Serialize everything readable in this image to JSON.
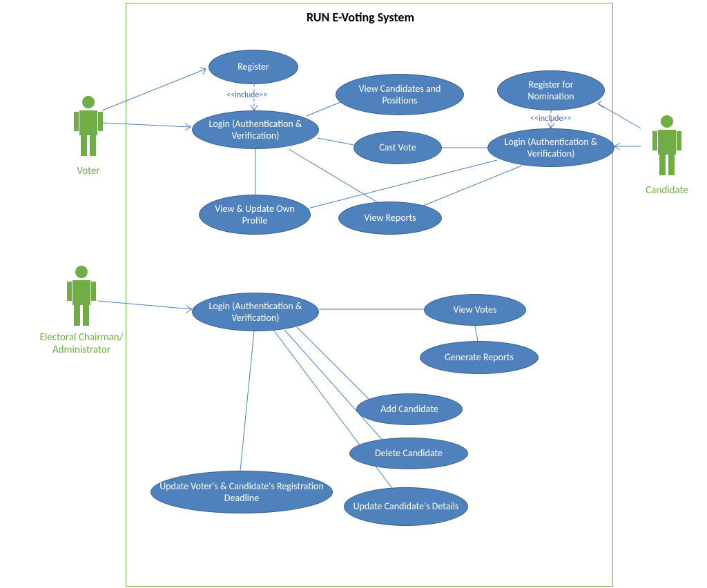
{
  "title": "RUN E-Voting System",
  "actors": {
    "voter": "Voter",
    "candidate": "Candidate",
    "admin_line1": "Electoral Chairman/",
    "admin_line2": "Administrator"
  },
  "usecases": {
    "register": "Register",
    "view_candidates": "View Candidates and Positions",
    "login_voter": "Login (Authentication & Verification)",
    "cast_vote": "Cast Vote",
    "register_nomination": "Register for Nomination",
    "login_candidate": "Login (Authentication & Verification)",
    "view_update_profile": "View & Update Own Profile",
    "view_reports": "View Reports",
    "login_admin": "Login (Authentication & Verification)",
    "view_votes": "View Votes",
    "generate_reports": "Generate Reports",
    "add_candidate": "Add Candidate",
    "delete_candidate": "Delete Candidate",
    "update_deadline": "Update Voter's & Candidate's Registration Deadline",
    "update_details": "Update Candidate's Details"
  },
  "stereotypes": {
    "include": "<<include>>"
  }
}
